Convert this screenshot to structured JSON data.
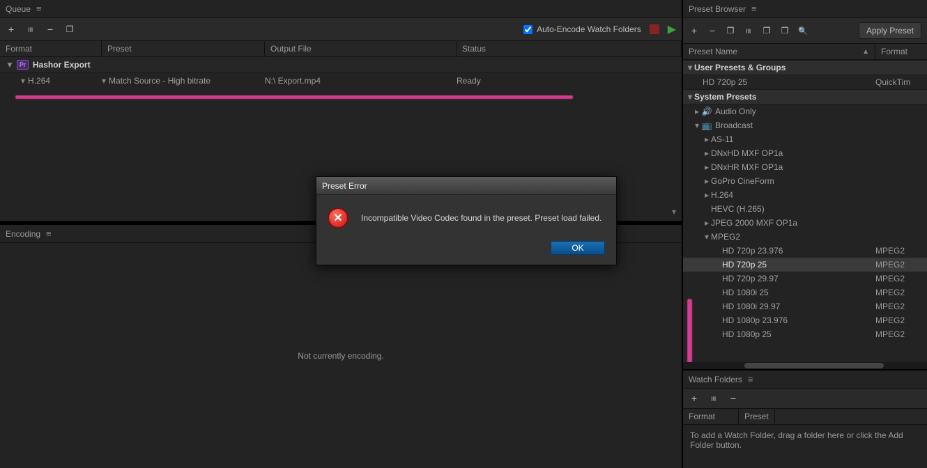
{
  "queue": {
    "title": "Queue",
    "autoEncode": "Auto-Encode Watch Folders",
    "headers": {
      "format": "Format",
      "preset": "Preset",
      "output": "Output File",
      "status": "Status"
    },
    "job": {
      "name": "Hashor Export",
      "format": "H.264",
      "preset": "Match Source - High bitrate",
      "output": "N:\\  Export.mp4",
      "status": "Ready"
    }
  },
  "encoding": {
    "title": "Encoding",
    "empty": "Not currently encoding."
  },
  "presetBrowser": {
    "title": "Preset Browser",
    "apply": "Apply Preset",
    "headers": {
      "name": "Preset Name",
      "format": "Format"
    },
    "sections": {
      "user": "User Presets & Groups",
      "system": "System Presets"
    },
    "userPresets": [
      {
        "label": "HD 720p 25",
        "format": "QuickTim"
      }
    ],
    "groups": [
      {
        "label": "Audio Only",
        "icon": "🔊",
        "expanded": false
      },
      {
        "label": "Broadcast",
        "icon": "📺",
        "expanded": true,
        "children": [
          {
            "label": "AS-11"
          },
          {
            "label": "DNxHD MXF OP1a"
          },
          {
            "label": "DNxHR MXF OP1a"
          },
          {
            "label": "GoPro CineForm"
          },
          {
            "label": "H.264"
          },
          {
            "label": "HEVC (H.265)",
            "leaf": true
          },
          {
            "label": "JPEG 2000 MXF OP1a"
          },
          {
            "label": "MPEG2",
            "expanded": true,
            "items": [
              {
                "label": "HD 720p 23.976",
                "format": "MPEG2"
              },
              {
                "label": "HD 720p 25",
                "format": "MPEG2",
                "selected": true
              },
              {
                "label": "HD 720p 29.97",
                "format": "MPEG2"
              },
              {
                "label": "HD 1080i 25",
                "format": "MPEG2"
              },
              {
                "label": "HD 1080i 29.97",
                "format": "MPEG2"
              },
              {
                "label": "HD 1080p 23.976",
                "format": "MPEG2"
              },
              {
                "label": "HD 1080p 25",
                "format": "MPEG2"
              }
            ]
          }
        ]
      }
    ]
  },
  "watchFolders": {
    "title": "Watch Folders",
    "headers": {
      "format": "Format",
      "preset": "Preset"
    },
    "empty": "To add a Watch Folder, drag a folder here or click the Add Folder button."
  },
  "dialog": {
    "title": "Preset Error",
    "message": "Incompatible Video Codec found in the preset. Preset load failed.",
    "ok": "OK"
  }
}
